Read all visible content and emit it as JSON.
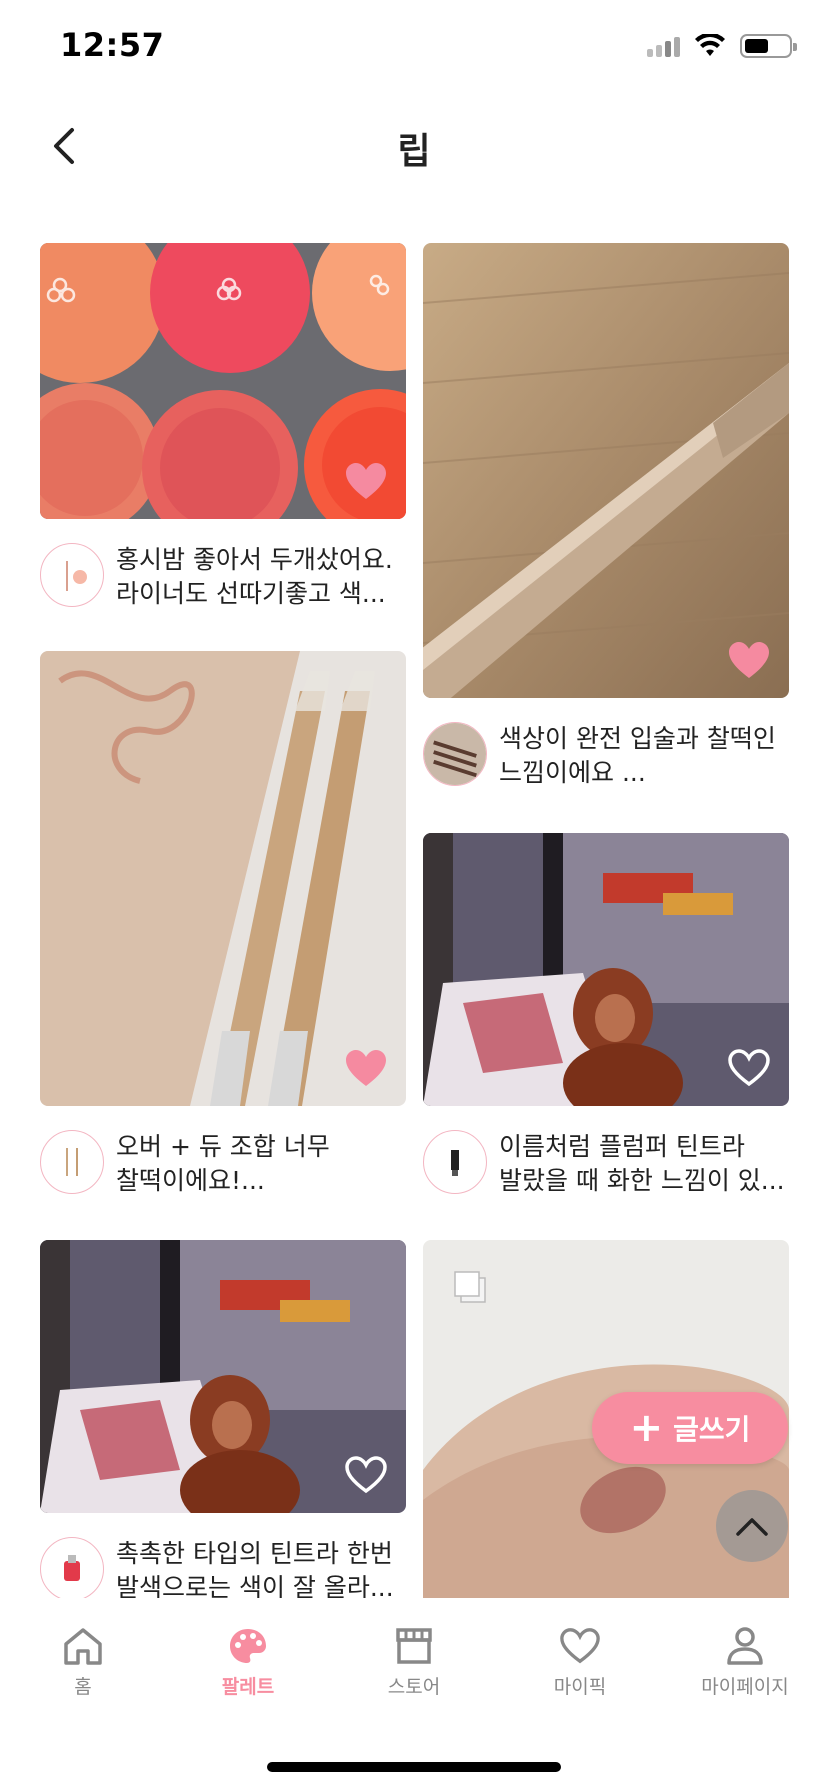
{
  "status_bar": {
    "time": "12:57"
  },
  "header": {
    "title": "립"
  },
  "posts": [
    {
      "caption": "홍시밤 좋아서 두개샀어요. 라이너도 선따기좋고 색...",
      "liked": true
    },
    {
      "caption": "색상이 완전 입술과 찰떡인 느낌이에요 ...",
      "liked": true
    },
    {
      "caption": "오버 + 듀 조합 너무 찰떡이에요!...",
      "liked": true
    },
    {
      "caption": "이름처럼 플럼퍼 틴트라 발랐을 때 화한 느낌이 있...",
      "liked": false
    },
    {
      "caption": "촉촉한 타입의 틴트라 한번 발색으로는 색이 잘 올라...",
      "liked": false
    },
    {
      "caption": "",
      "liked": false
    }
  ],
  "write_button": {
    "label": "글쓰기"
  },
  "tabs": [
    {
      "label": "홈",
      "icon": "home-icon",
      "active": false
    },
    {
      "label": "팔레트",
      "icon": "palette-icon",
      "active": true
    },
    {
      "label": "스토어",
      "icon": "store-icon",
      "active": false
    },
    {
      "label": "마이픽",
      "icon": "heart-icon",
      "active": false
    },
    {
      "label": "마이페이지",
      "icon": "person-icon",
      "active": false
    }
  ],
  "colors": {
    "accent": "#f78da0",
    "heart_filled": "#f58aa0",
    "avatar_border": "#f3b6c2"
  }
}
